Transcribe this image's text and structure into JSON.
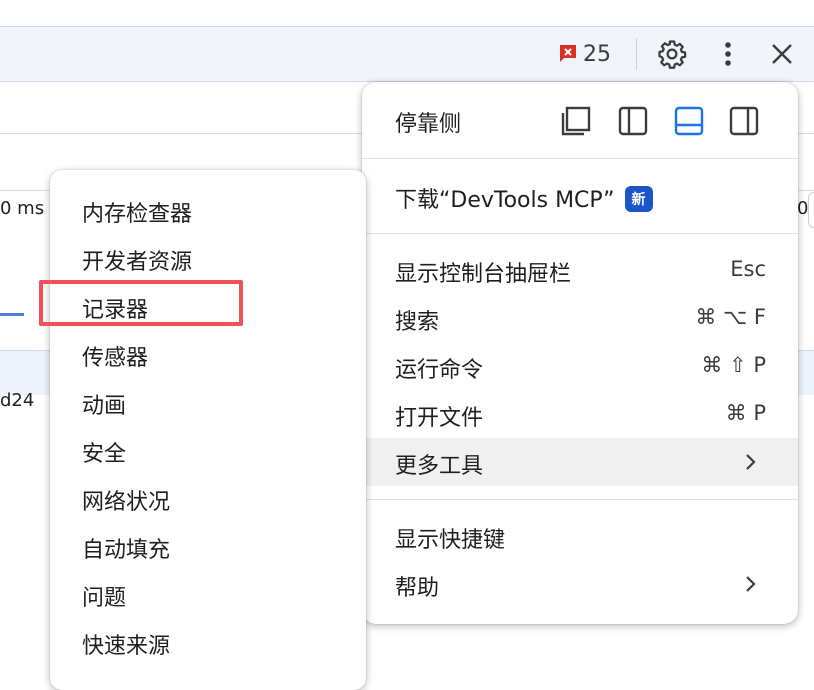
{
  "toolbar": {
    "issues_count": "25"
  },
  "background": {
    "left_text": "0 ms",
    "right_text": "0",
    "row_text": "d24"
  },
  "menu": {
    "dock_label": "停靠侧",
    "items": [
      {
        "label": "下载“DevTools MCP”",
        "badge": "新"
      },
      {
        "label": "显示控制台抽屉栏",
        "shortcut": "Esc"
      },
      {
        "label": "搜索",
        "shortcut": "⌘ ⌥ F"
      },
      {
        "label": "运行命令",
        "shortcut": "⌘ ⇧ P"
      },
      {
        "label": "打开文件",
        "shortcut": "⌘ P"
      },
      {
        "label": "更多工具",
        "submenu": true
      },
      {
        "label": "显示快捷键"
      },
      {
        "label": "帮助",
        "submenu": true
      }
    ]
  },
  "submenu": {
    "items": [
      {
        "label": "内存检查器"
      },
      {
        "label": "开发者资源"
      },
      {
        "label": "记录器"
      },
      {
        "label": "传感器"
      },
      {
        "label": "动画"
      },
      {
        "label": "安全"
      },
      {
        "label": "网络状况"
      },
      {
        "label": "自动填充"
      },
      {
        "label": "问题"
      },
      {
        "label": "快速来源"
      }
    ]
  },
  "colors": {
    "accent": "#1a73e8",
    "highlight_box": "#f0515a",
    "issue_flag": "#d93025"
  }
}
